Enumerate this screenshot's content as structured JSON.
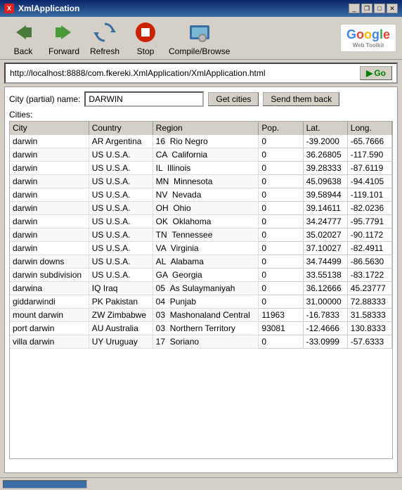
{
  "window": {
    "title": "XmlApplication",
    "icon": "X"
  },
  "titlebar": {
    "minimize_label": "_",
    "maximize_label": "□",
    "restore_label": "❐",
    "close_label": "✕"
  },
  "toolbar": {
    "back_label": "Back",
    "forward_label": "Forward",
    "refresh_label": "Refresh",
    "stop_label": "Stop",
    "compile_label": "Compile/Browse"
  },
  "google": {
    "logo": "Google",
    "sub": "Web Toolkit"
  },
  "address": {
    "url": "http://localhost:8888/com.fkereki.XmlApplication/XmlApplication.html",
    "go_label": "Go",
    "go_arrow": "▶"
  },
  "search": {
    "label": "City (partial) name:",
    "value": "DARWIN",
    "get_cities_label": "Get cities",
    "send_back_label": "Send them back"
  },
  "cities_label": "Cities:",
  "table": {
    "headers": [
      "City",
      "Country",
      "Region",
      "Pop.",
      "Lat.",
      "Long."
    ],
    "rows": [
      {
        "city": "darwin",
        "country_code": "AR",
        "country": "Argentina",
        "region_code": "16",
        "region": "Rio Negro",
        "pop": "0",
        "lat": "-39.2000",
        "long": "-65.7666"
      },
      {
        "city": "darwin",
        "country_code": "US",
        "country": "U.S.A.",
        "region_code": "CA",
        "region": "California",
        "pop": "0",
        "lat": "36.26805",
        "long": "-117.590"
      },
      {
        "city": "darwin",
        "country_code": "US",
        "country": "U.S.A.",
        "region_code": "IL",
        "region": "Illinois",
        "pop": "0",
        "lat": "39.28333",
        "long": "-87.6119"
      },
      {
        "city": "darwin",
        "country_code": "US",
        "country": "U.S.A.",
        "region_code": "MN",
        "region": "Minnesota",
        "pop": "0",
        "lat": "45.09638",
        "long": "-94.4105"
      },
      {
        "city": "darwin",
        "country_code": "US",
        "country": "U.S.A.",
        "region_code": "NV",
        "region": "Nevada",
        "pop": "0",
        "lat": "39.58944",
        "long": "-119.101"
      },
      {
        "city": "darwin",
        "country_code": "US",
        "country": "U.S.A.",
        "region_code": "OH",
        "region": "Ohio",
        "pop": "0",
        "lat": "39.14611",
        "long": "-82.0236"
      },
      {
        "city": "darwin",
        "country_code": "US",
        "country": "U.S.A.",
        "region_code": "OK",
        "region": "Oklahoma",
        "pop": "0",
        "lat": "34.24777",
        "long": "-95.7791"
      },
      {
        "city": "darwin",
        "country_code": "US",
        "country": "U.S.A.",
        "region_code": "TN",
        "region": "Tennessee",
        "pop": "0",
        "lat": "35.02027",
        "long": "-90.1172"
      },
      {
        "city": "darwin",
        "country_code": "US",
        "country": "U.S.A.",
        "region_code": "VA",
        "region": "Virginia",
        "pop": "0",
        "lat": "37.10027",
        "long": "-82.4911"
      },
      {
        "city": "darwin downs",
        "country_code": "US",
        "country": "U.S.A.",
        "region_code": "AL",
        "region": "Alabama",
        "pop": "0",
        "lat": "34.74499",
        "long": "-86.5630"
      },
      {
        "city": "darwin subdivision",
        "country_code": "US",
        "country": "U.S.A.",
        "region_code": "GA",
        "region": "Georgia",
        "pop": "0",
        "lat": "33.55138",
        "long": "-83.1722"
      },
      {
        "city": "darwina",
        "country_code": "IQ",
        "country": "Iraq",
        "region_code": "05",
        "region": "As Sulaymaniyah",
        "pop": "0",
        "lat": "36.12666",
        "long": "45.23777"
      },
      {
        "city": "giddarwindi",
        "country_code": "PK",
        "country": "Pakistan",
        "region_code": "04",
        "region": "Punjab",
        "pop": "0",
        "lat": "31.00000",
        "long": "72.88333"
      },
      {
        "city": "mount darwin",
        "country_code": "ZW",
        "country": "Zimbabwe",
        "region_code": "03",
        "region": "Mashonaland Central",
        "pop": "11963",
        "lat": "-16.7833",
        "long": "31.58333"
      },
      {
        "city": "port darwin",
        "country_code": "AU",
        "country": "Australia",
        "region_code": "03",
        "region": "Northern Territory",
        "pop": "93081",
        "lat": "-12.4666",
        "long": "130.8333"
      },
      {
        "city": "villa darwin",
        "country_code": "UY",
        "country": "Uruguay",
        "region_code": "17",
        "region": "Soriano",
        "pop": "0",
        "lat": "-33.0999",
        "long": "-57.6333"
      }
    ]
  }
}
